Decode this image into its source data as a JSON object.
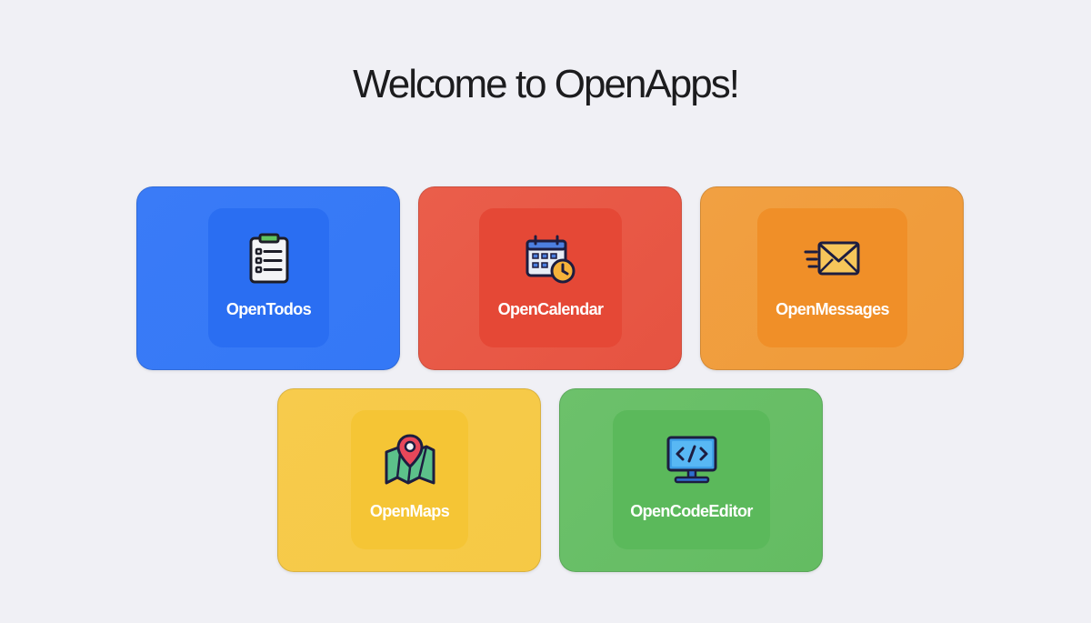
{
  "page": {
    "title": "Welcome to OpenApps!"
  },
  "apps": [
    {
      "label": "OpenTodos",
      "icon": "clipboard-checklist-icon",
      "color": "#3578f6",
      "inner_color": "#2a6ef2"
    },
    {
      "label": "OpenCalendar",
      "icon": "calendar-clock-icon",
      "color": "#e75a45",
      "inner_color": "#e54836"
    },
    {
      "label": "OpenMessages",
      "icon": "envelope-icon",
      "color": "#f09a38",
      "inner_color": "#f08f28"
    },
    {
      "label": "OpenMaps",
      "icon": "map-pin-icon",
      "color": "#f6c945",
      "inner_color": "#f5c535"
    },
    {
      "label": "OpenCodeEditor",
      "icon": "code-monitor-icon",
      "color": "#68bf67",
      "inner_color": "#5bb95b"
    }
  ]
}
